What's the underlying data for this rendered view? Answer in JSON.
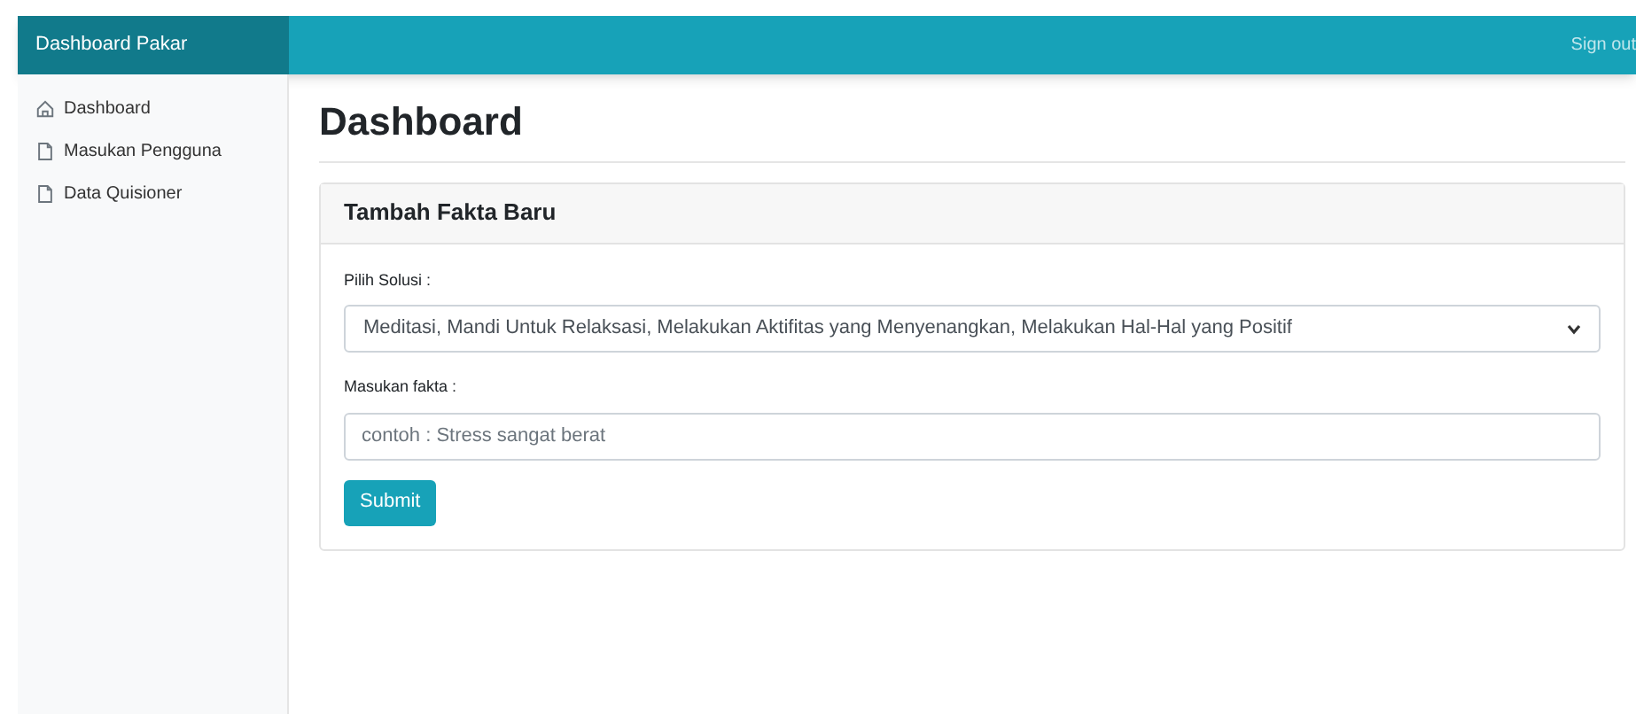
{
  "navbar": {
    "brand": "Dashboard Pakar",
    "signout": "Sign out"
  },
  "sidebar": {
    "items": [
      {
        "label": "Dashboard",
        "kind": "home"
      },
      {
        "label": "Masukan Pengguna",
        "kind": "file"
      },
      {
        "label": "Data Quisioner",
        "kind": "file"
      }
    ]
  },
  "page": {
    "title": "Dashboard"
  },
  "card": {
    "title": "Tambah Fakta Baru",
    "solution": {
      "label": "Pilih Solusi :",
      "value": "Meditasi, Mandi Untuk Relaksasi, Melakukan Aktifitas yang Menyenangkan, Melakukan Hal-Hal yang Positif"
    },
    "fact": {
      "label": "Masukan fakta :",
      "placeholder": "contoh : Stress sangat berat"
    },
    "submit": "Submit"
  }
}
